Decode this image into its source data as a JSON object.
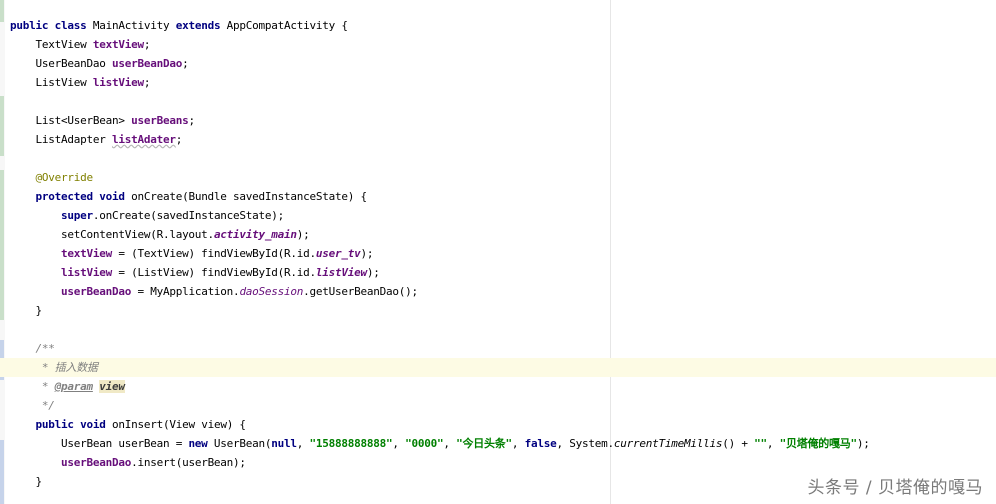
{
  "editor": {
    "class_decl": {
      "modifiers": "public class",
      "name": " MainActivity ",
      "extends_kw": "extends",
      "parent": " AppCompatActivity {"
    },
    "fields": [
      {
        "type": "TextView ",
        "name": "textView",
        "end": ";"
      },
      {
        "type": "UserBeanDao ",
        "name": "userBeanDao",
        "end": ";"
      },
      {
        "type": "ListView ",
        "name": "listView",
        "end": ";"
      },
      {
        "type": "List<UserBean> ",
        "name": "userBeans",
        "end": ";"
      },
      {
        "type": "ListAdapter ",
        "name": "listAdater",
        "end": ";"
      }
    ],
    "override_annotation": "@Override",
    "on_create": {
      "modifiers": "protected void",
      "signature": " onCreate(Bundle savedInstanceState) {",
      "line1_kw": "super",
      "line1_rest": ".onCreate(savedInstanceState);",
      "line2_pre": "setContentView(R.layout.",
      "line2_field": "activity_main",
      "line2_post": ");",
      "line3_field": "textView",
      "line3_mid": " = (TextView) findViewById(R.id.",
      "line3_id": "user_tv",
      "line3_post": ");",
      "line4_field": "listView",
      "line4_mid": " = (ListView) findViewById(R.id.",
      "line4_id": "listView",
      "line4_post": ");",
      "line5_field": "userBeanDao",
      "line5_mid": " = MyApplication.",
      "line5_static": "daoSession",
      "line5_post": ".getUserBeanDao();",
      "close": "}"
    },
    "javadoc": {
      "open": "/**",
      "desc": " * 插入数据",
      "param_prefix": " * ",
      "param_tag": "@param",
      "param_name": "view",
      "close": " */"
    },
    "on_insert": {
      "modifiers": "public void",
      "signature": " onInsert(View view) {",
      "l1_a": "UserBean userBean = ",
      "l1_new": "new",
      "l1_b": " UserBean(",
      "l1_null": "null",
      "l1_c": ", ",
      "l1_s1": "\"15888888888\"",
      "l1_d": ", ",
      "l1_s2": "\"0000\"",
      "l1_e": ", ",
      "l1_s3": "\"今日头条\"",
      "l1_f": ", ",
      "l1_false": "false",
      "l1_g": ", System.",
      "l1_method": "currentTimeMillis",
      "l1_h": "() + ",
      "l1_s4": "\"\"",
      "l1_i": ", ",
      "l1_s5": "\"贝塔俺的嘎马\"",
      "l1_j": ");",
      "l2_field": "userBeanDao",
      "l2_rest": ".insert(userBean);",
      "close": "}"
    }
  },
  "watermark": "头条号 / 贝塔俺的嘎马",
  "icons": {
    "gutter_hint": "lightbulb-icon"
  },
  "colors": {
    "keyword": "#000080",
    "field": "#660e7a",
    "string": "#008000",
    "comment": "#808080",
    "annotation": "#808000"
  }
}
